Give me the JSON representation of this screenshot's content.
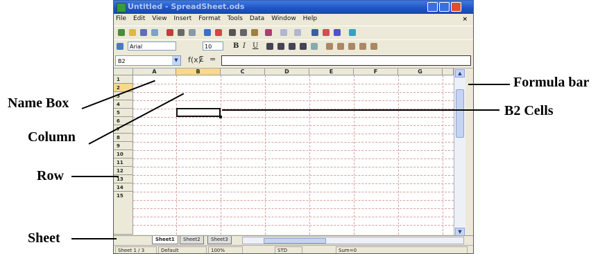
{
  "window": {
    "title": "Untitled - SpreadSheet.ods"
  },
  "menubar": {
    "items": [
      "File",
      "Edit",
      "View",
      "Insert",
      "Format",
      "Tools",
      "Data",
      "Window",
      "Help"
    ],
    "close_doc": "×"
  },
  "format_toolbar": {
    "font_name": "Arial",
    "font_size": "10",
    "bold": "B",
    "italic": "I",
    "underline": "U"
  },
  "formula_bar": {
    "name_box_value": "B2",
    "function_icon": "f(x)",
    "sum_symbol": "Σ",
    "equals_symbol": "="
  },
  "grid": {
    "columns": [
      "A",
      "B",
      "C",
      "D",
      "E",
      "F",
      "G"
    ],
    "selected_column": "B",
    "rows": [
      "1",
      "2",
      "3",
      "4",
      "5",
      "6",
      "7",
      "8",
      "9",
      "10",
      "11",
      "12",
      "13",
      "14",
      "15"
    ],
    "selected_row": "2"
  },
  "sheet_tabs": {
    "tabs": [
      "Sheet1",
      "Sheet2",
      "Sheet3"
    ],
    "active": "Sheet1"
  },
  "statusbar": {
    "sheet": "Sheet 1 / 3",
    "style": "Default",
    "zoom": "100%",
    "mode": "STD",
    "sum": "Sum=0"
  },
  "annotations": {
    "formula_bar": "Formula bar",
    "name_box": "Name Box",
    "column": "Column",
    "row": "Row",
    "cell": "B2 Cells",
    "sheet": "Sheet"
  }
}
